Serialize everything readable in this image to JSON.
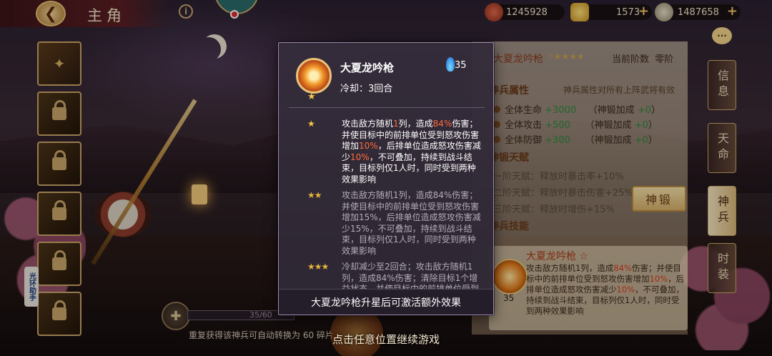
{
  "header": {
    "title": "主角",
    "back_glyph": "❮"
  },
  "resources": [
    {
      "name": "stamina",
      "value": "1245928",
      "icon": "token-icon"
    },
    {
      "name": "gold-ingot",
      "value": "1573",
      "icon": "ingot-icon"
    },
    {
      "name": "copper-coin",
      "value": "1487658",
      "icon": "coin-icon"
    }
  ],
  "helper_label": "光环助手",
  "right_panel": {
    "weapon_name": "大夏龙吟枪",
    "stars": "☆★★★★",
    "level_label": "当前阶数",
    "level_value": "零阶",
    "attr_section": "神兵属性",
    "attr_note": "神兵属性对所有上阵武将有效",
    "attrs": [
      {
        "label": "全体生命",
        "value": "+3000",
        "bonus_label": "（神锻加成",
        "bonus": "+0",
        "close": "）"
      },
      {
        "label": "全体攻击",
        "value": "+500",
        "bonus_label": "（神锻加成",
        "bonus": "+0",
        "close": "）"
      },
      {
        "label": "全体防御",
        "value": "+300",
        "bonus_label": "（神锻加成",
        "bonus": "+0",
        "close": "）"
      }
    ],
    "talent_section": "神锻天赋",
    "talents": [
      "一阶天赋：释放时暴击率+10%",
      "二阶天赋：释放时暴击伤害+25%",
      "三阶天赋：释放时增伤+15%"
    ],
    "forge_button": "神锻",
    "skill_section": "神兵技能",
    "skill": {
      "name": "大夏龙吟枪 ☆",
      "energy": "35",
      "desc_1": "攻击敌方随机1列，造成",
      "desc_pct1": "84%",
      "desc_2": "伤害；并使目标中的前排单位受到怒攻伤害增加",
      "desc_pct2": "10%",
      "desc_3": "，后排单位造成怒攻伤害减少",
      "desc_pct3": "10%",
      "desc_4": "，不可叠加，持续到战斗结束，目标列仅1人时，同时受到两种效果影响"
    }
  },
  "tabs": [
    {
      "label": "信息",
      "active": false
    },
    {
      "label": "天命",
      "active": false
    },
    {
      "label": "神兵",
      "active": true
    },
    {
      "label": "时装",
      "active": false
    }
  ],
  "bottom": {
    "progress_text": "35/60",
    "convert_hint": "重复获得该神兵可自动转换为 60 碎片",
    "continue_hint": "点击任意位置继续游戏"
  },
  "popup": {
    "name": "大夏龙吟枪",
    "cooldown": "冷却：3回合",
    "energy": "35",
    "tiers": [
      {
        "stars": "★",
        "p1": "攻击敌方随机",
        "n1": "1",
        "p2": "列，造成",
        "n2": "84%",
        "p3": "伤害；并使目标中的前排单位受到怒攻伤害增加",
        "n3": "10%",
        "p4": "，后排单位造成怒攻伤害减少",
        "n4": "10%",
        "p5": "，不可叠加，持续到战斗结束，目标列仅1人时，同时受到两种效果影响"
      },
      {
        "stars": "★★",
        "text": "攻击敌方随机1列，造成84%伤害；并使目标中的前排单位受到怒攻伤害增加15%，后排单位造成怒攻伤害减少15%，不可叠加，持续到战斗结束，目标列仅1人时，同时受到两种效果影响"
      },
      {
        "stars": "★★★",
        "text": "冷却减少至2回合；攻击敌方随机1列，造成84%伤害；清除目标1个增益状态，并使目标中的前排单位受到"
      }
    ],
    "footer": "大夏龙吟枪升星后可激活额外效果"
  }
}
